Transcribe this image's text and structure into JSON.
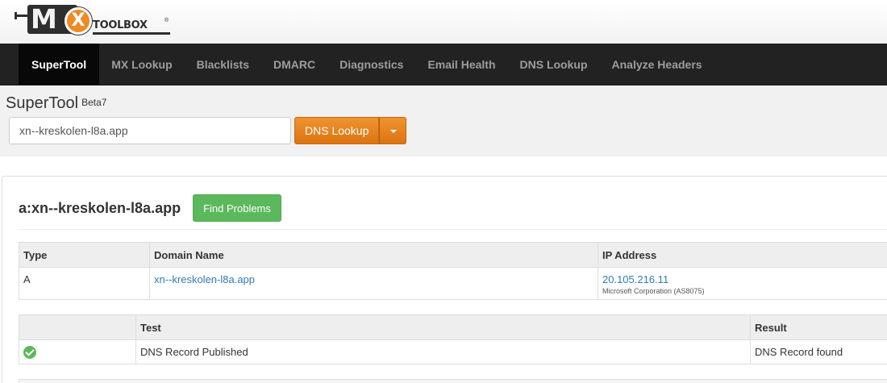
{
  "logo": {
    "mx": "M",
    "x": "X",
    "toolbox": "TOOLBOX",
    "reg": "®"
  },
  "nav": {
    "items": [
      {
        "label": "SuperTool",
        "active": true
      },
      {
        "label": "MX Lookup"
      },
      {
        "label": "Blacklists"
      },
      {
        "label": "DMARC"
      },
      {
        "label": "Diagnostics"
      },
      {
        "label": "Email Health"
      },
      {
        "label": "DNS Lookup"
      },
      {
        "label": "Analyze Headers"
      }
    ]
  },
  "tool": {
    "title": "SuperTool",
    "beta": "Beta7",
    "search_value": "xn--kreskolen-l8a.app",
    "lookup_label": "DNS Lookup"
  },
  "result": {
    "title": "a:xn--kreskolen-l8a.app",
    "find_problems_label": "Find Problems"
  },
  "dns_table": {
    "headers": [
      "Type",
      "Domain Name",
      "IP Address"
    ],
    "rows": [
      {
        "type": "A",
        "domain": "xn--kreskolen-l8a.app",
        "ip": "20.105.216.11",
        "ip_owner": "Microsoft Corporation (AS8075)"
      }
    ]
  },
  "test_table": {
    "headers": [
      "",
      "Test",
      "Result"
    ],
    "rows": [
      {
        "status_icon": "check-circle-icon",
        "test": "DNS Record Published",
        "result": "DNS Record found"
      }
    ]
  },
  "colors": {
    "nav_bg": "#222222",
    "accent_orange": "#f0932f",
    "success_green": "#5cb85c",
    "link_blue": "#337ab7"
  }
}
